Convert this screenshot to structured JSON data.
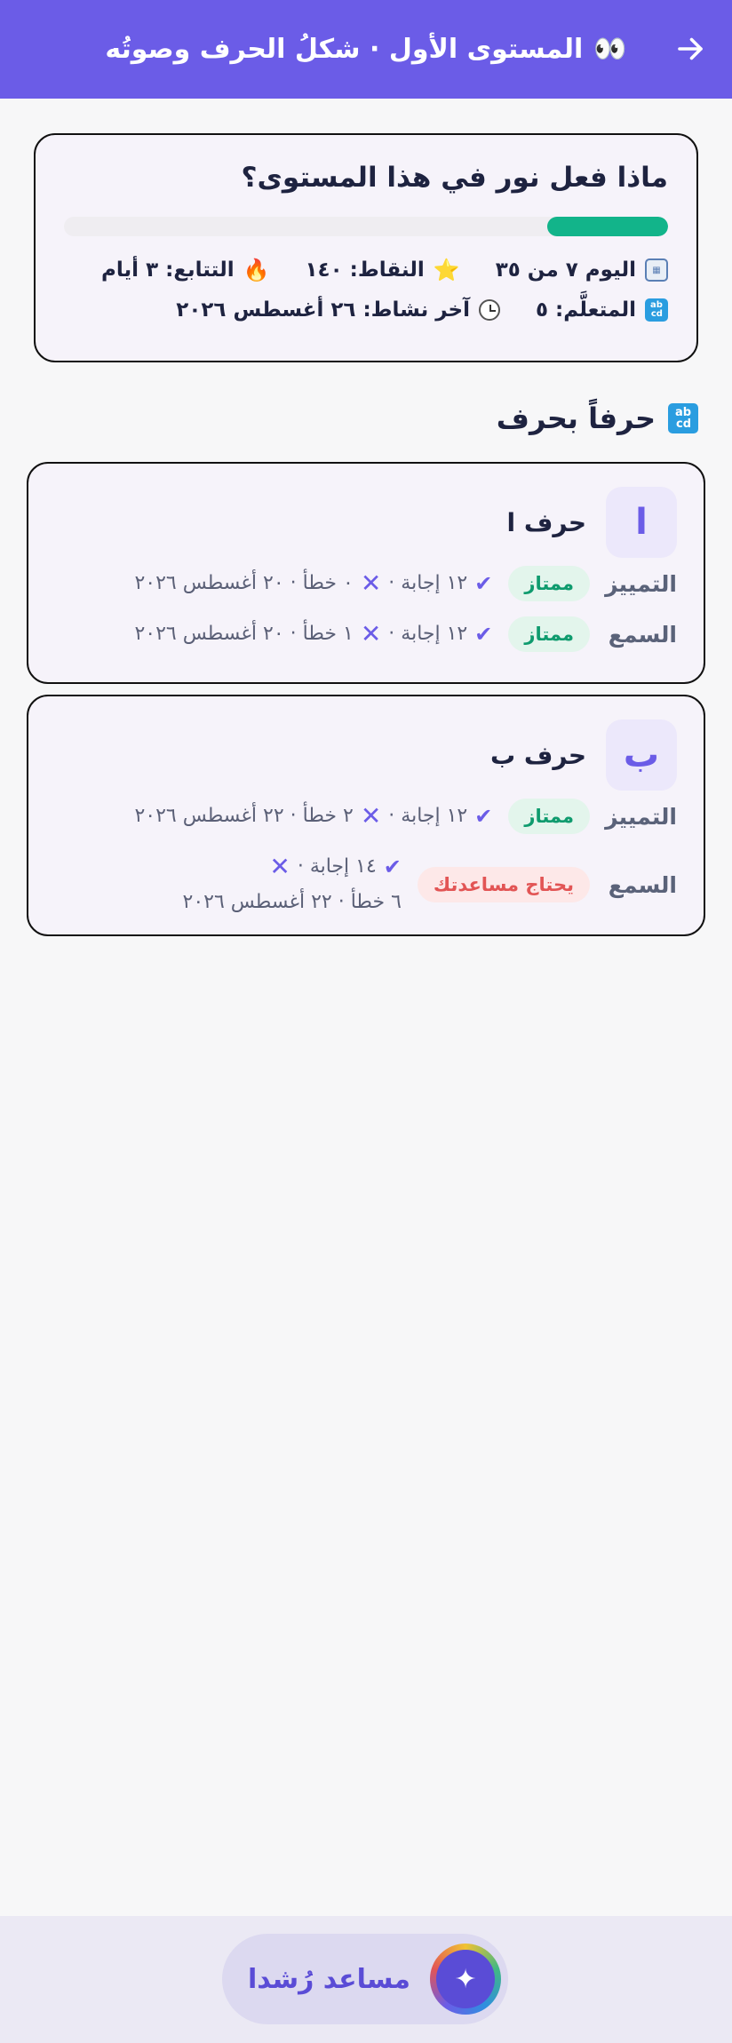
{
  "header": {
    "title": "المستوى الأول · شكلُ الحرف وصوتُه",
    "eyes_icon": "👀",
    "back_icon": "arrow-right-icon"
  },
  "summary": {
    "title": "ماذا فعل نور في هذا المستوى؟",
    "progress_fraction": 0.2,
    "day": "اليوم ٧ من ٣٥",
    "points": "النقاط: ١٤٠",
    "streak": "التتابع: ٣ أيام",
    "learned": "المتعلَّم: ٥",
    "last_active": "آخر نشاط: ٢٦ أغسطس ٢٠٢٦",
    "star_icon": "⭐",
    "fire_icon": "🔥",
    "colors": {
      "progress": "#12b48a",
      "accent": "#6b5ce7"
    }
  },
  "section": {
    "title": "حرفاً بحرف"
  },
  "letters": [
    {
      "glyph": "ا",
      "name": "حرف ا",
      "skills": [
        {
          "name": "التمييز",
          "badge": "ممتاز",
          "answers": "١٢ إجابة ·",
          "mistakes": "٠ خطأ · ٢٠ أغسطس ٢٠٢٦"
        },
        {
          "name": "السمع",
          "badge": "ممتاز",
          "answers": "١٢ إجابة ·",
          "mistakes": "١ خطأ · ٢٠ أغسطس ٢٠٢٦"
        }
      ]
    },
    {
      "glyph": "ب",
      "name": "حرف ب",
      "skills": [
        {
          "name": "التمييز",
          "badge": "ممتاز",
          "answers": "١٢ إجابة ·",
          "mistakes": "٢ خطأ · ٢٢ أغسطس ٢٠٢٦"
        },
        {
          "name": "السمع",
          "badge": "يحتاج مساعدتك",
          "answers": "١٤ إجابة ·",
          "mistakes": "٦ خطأ · ٢٢ أغسطس ٢٠٢٦"
        }
      ]
    }
  ],
  "footer": {
    "assistant_label": "مساعد رُشدا"
  }
}
